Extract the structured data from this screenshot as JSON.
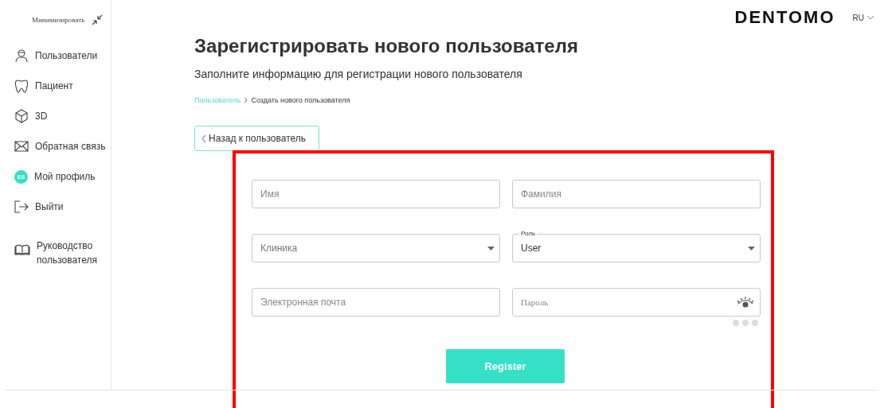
{
  "sidebar": {
    "minimize": "Минимизировать",
    "items": [
      {
        "kind": "users",
        "label": "Пользователи"
      },
      {
        "kind": "patient",
        "label": "Пациент"
      },
      {
        "kind": "cube",
        "label": "3D"
      },
      {
        "kind": "mail",
        "label": "Обратная связь"
      },
      {
        "kind": "avatar",
        "label": "Мой профиль",
        "initials": "ES"
      },
      {
        "kind": "logout",
        "label": "Выйти"
      },
      {
        "kind": "book",
        "label": "Руководство пользователя"
      }
    ]
  },
  "header": {
    "logo": "DENTOMO",
    "language": "RU"
  },
  "page": {
    "title": "Зарегистрировать нового пользователя",
    "subtitle": "Заполните информацию для регистрации нового пользователя",
    "breadcrumb": [
      {
        "label": "Пользователь",
        "link": true
      },
      {
        "label": "Создать нового пользователя",
        "link": false
      }
    ],
    "back_button": "Назад к пользователь"
  },
  "form": {
    "fields": [
      {
        "kind": "text",
        "placeholder": "Имя"
      },
      {
        "kind": "select",
        "placeholder": "Клиника"
      },
      {
        "kind": "text",
        "placeholder": "Электронная почта"
      },
      {
        "kind": "text",
        "placeholder": "Фамилия"
      },
      {
        "kind": "select",
        "label": "Роль",
        "value": "User"
      },
      {
        "kind": "password",
        "placeholder": "Пароль"
      }
    ],
    "submit": "Register"
  }
}
